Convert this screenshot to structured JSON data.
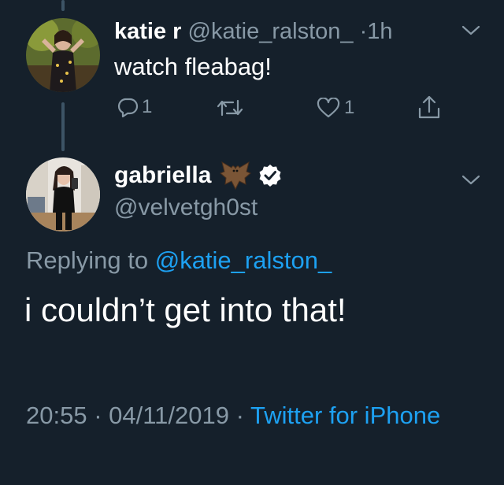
{
  "original_tweet": {
    "display_name": "katie r",
    "handle": "@katie_ralston_",
    "separator": "·",
    "time": "1h",
    "text": "watch fleabag!",
    "actions": {
      "reply_count": "1",
      "like_count": "1"
    }
  },
  "reply_tweet": {
    "display_name": "gabriella",
    "emoji": "🦇",
    "handle": "@velvetgh0st",
    "replying_prefix": "Replying to",
    "replying_handle": "@katie_ralston_",
    "text": "i couldn’t get into that!",
    "timestamp": "20:55 · 04/11/2019 ·",
    "source": "Twitter for iPhone"
  },
  "colors": {
    "background": "#15202b",
    "muted": "#8899a6",
    "accent": "#1da1f2"
  },
  "icons": [
    "chevron-down-icon",
    "reply-icon",
    "retweet-icon",
    "like-icon",
    "share-icon",
    "verified-badge-icon",
    "bat-emoji"
  ]
}
